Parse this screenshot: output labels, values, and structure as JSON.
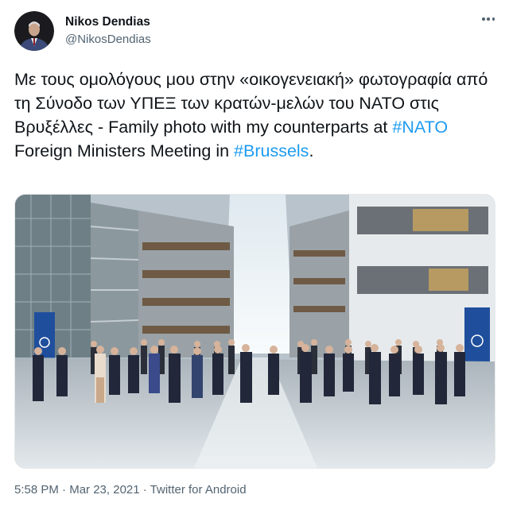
{
  "author": {
    "display_name": "Nikos Dendias",
    "handle": "@NikosDendias"
  },
  "tweet": {
    "text_plain": "Με τους ομολόγους μου στην «οικογενειακή» φωτογραφία από τη Σύνοδο των ΥΠΕΞ των κρατών-μελών του ΝΑΤΟ στις Βρυξέλλες - Family photo with my counterparts at ",
    "hashtag_nato": "#NATO",
    "text_middle": " Foreign Ministers Meeting in ",
    "hashtag_brussels": "#Brussels",
    "text_end": "."
  },
  "meta": {
    "time": "5:58 PM",
    "separator": " · ",
    "date": "Mar 23, 2021",
    "source": "Twitter for Android"
  },
  "colors": {
    "link": "#1d9bf0",
    "secondary_text": "#536471",
    "primary_text": "#0f1419",
    "nato_banner": "#1f4f9c"
  },
  "icons": {
    "more": "more-options-icon",
    "avatar": "profile-avatar"
  }
}
